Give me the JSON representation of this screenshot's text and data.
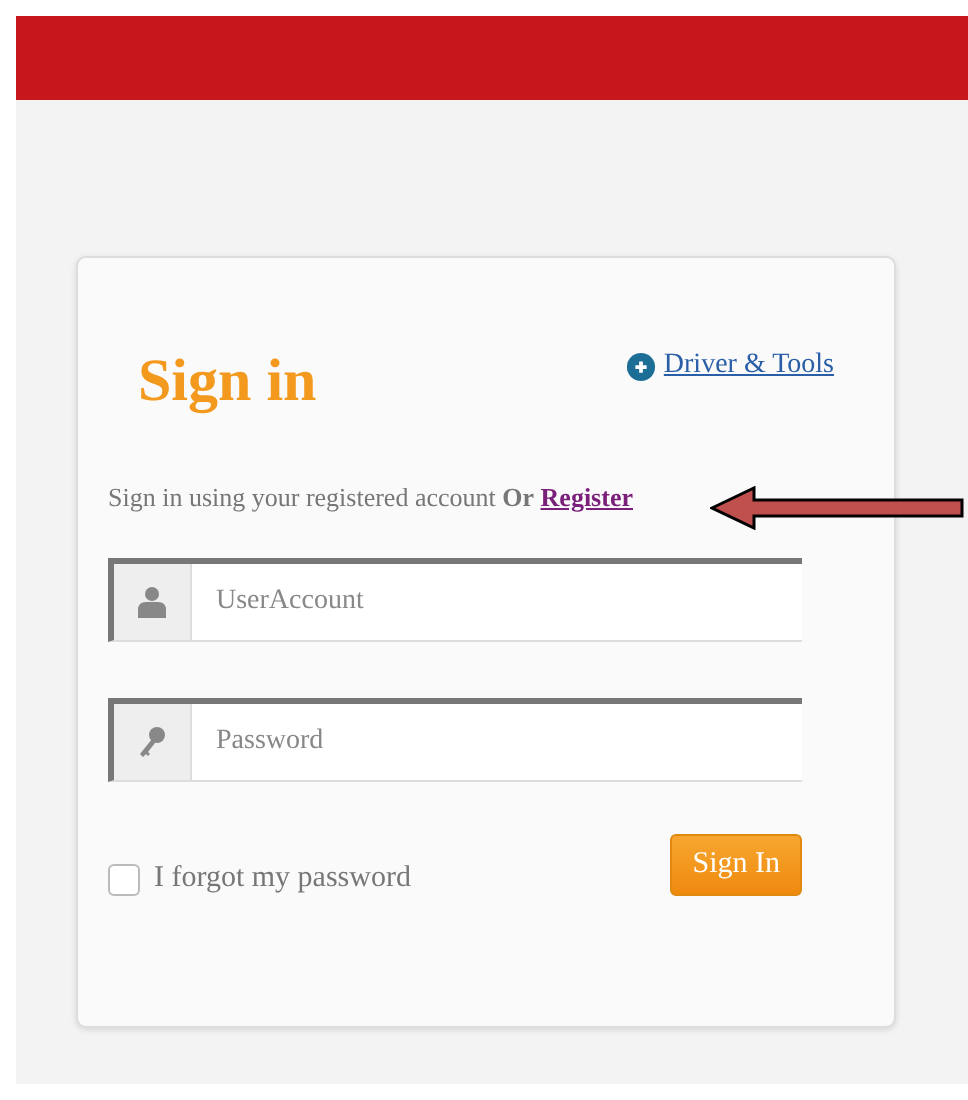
{
  "header": {
    "kind": "bar"
  },
  "signin": {
    "title": "Sign in",
    "tools_link": "Driver & Tools",
    "intro": "Sign in using your registered account **Or**",
    "register_link": "Register",
    "fields": [
      {
        "kind": "user",
        "placeholder": "UserAccount"
      },
      {
        "kind": "password",
        "placeholder": "Password"
      }
    ],
    "forgot": {
      "label": "I forgot my password",
      "checked": false
    },
    "submit": "Sign In"
  },
  "annotation": {
    "kind": "arrow"
  }
}
